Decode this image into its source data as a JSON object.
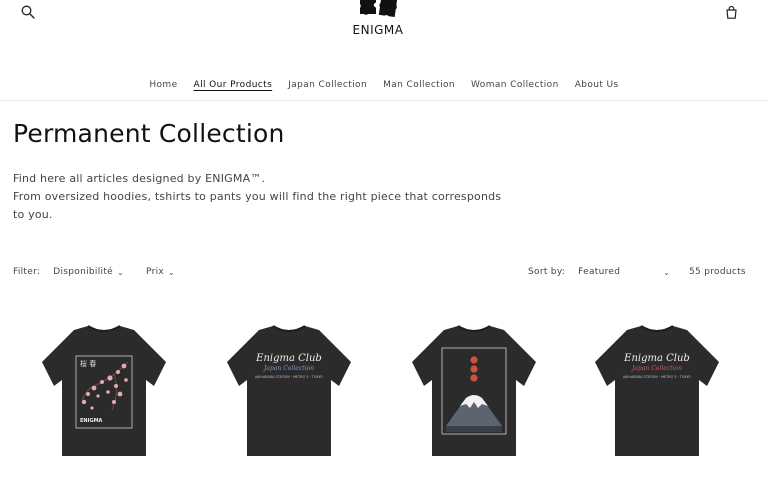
{
  "brand": {
    "name": "ENIGMA"
  },
  "nav": {
    "items": [
      {
        "label": "Home"
      },
      {
        "label": "All Our Products"
      },
      {
        "label": "Japan Collection"
      },
      {
        "label": "Man Collection"
      },
      {
        "label": "Woman Collection"
      },
      {
        "label": "About Us"
      }
    ],
    "active_index": 1
  },
  "collection": {
    "title": "Permanent Collection",
    "description_line1": "Find here all articles designed by ENIGMA™.",
    "description_line2": "From oversized hoodies, tshirts to pants you will find the right piece that corresponds to you."
  },
  "filters": {
    "label": "Filter:",
    "availability_label": "Disponibilité",
    "price_label": "Prix"
  },
  "sort": {
    "label": "Sort by:",
    "selected": "Featured"
  },
  "product_count": "55 products",
  "products": [
    {
      "print": "cherry-blossom",
      "tag": "ENIGMA"
    },
    {
      "print": "enigma-club",
      "headline": "Enigma Club",
      "subline": "Japan Collection",
      "small_text": "AKIHABARA STATION · METRO 5 · TOKYO",
      "script_color": "#7a9fc8"
    },
    {
      "print": "mount-fuji"
    },
    {
      "print": "enigma-club",
      "headline": "Enigma Club",
      "subline": "Japan Collection",
      "small_text": "AKIHABARA STATION · METRO 5 · TOKYO",
      "script_color": "#d45a5a"
    }
  ],
  "colors": {
    "shirt": "#2b2b2b",
    "shirt_shadow": "#1f1f1f",
    "text": "#333333"
  },
  "icons": {
    "search": "search-icon",
    "cart": "cart-icon",
    "logo": "puzzle-logo-icon"
  }
}
